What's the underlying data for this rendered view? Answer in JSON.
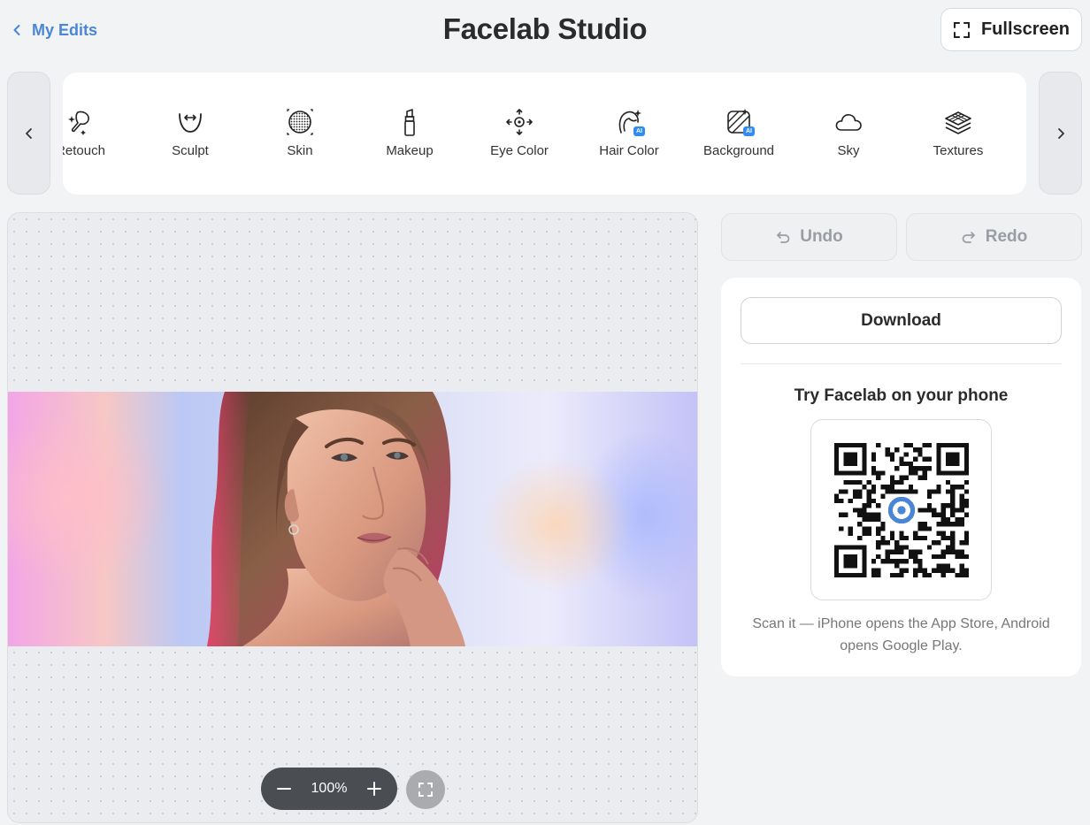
{
  "header": {
    "back_label": "My Edits",
    "title": "Facelab Studio",
    "fullscreen_label": "Fullscreen"
  },
  "tools": [
    {
      "label": "Retouch",
      "icon": "retouch-icon",
      "ai": false
    },
    {
      "label": "Sculpt",
      "icon": "sculpt-icon",
      "ai": false
    },
    {
      "label": "Skin",
      "icon": "skin-icon",
      "ai": false
    },
    {
      "label": "Makeup",
      "icon": "lipstick-icon",
      "ai": false
    },
    {
      "label": "Eye Color",
      "icon": "eye-move-icon",
      "ai": false
    },
    {
      "label": "Hair Color",
      "icon": "hair-icon",
      "ai": true
    },
    {
      "label": "Background",
      "icon": "background-icon",
      "ai": true
    },
    {
      "label": "Sky",
      "icon": "cloud-icon",
      "ai": false
    },
    {
      "label": "Textures",
      "icon": "layers-icon",
      "ai": false
    }
  ],
  "ai_badge": "AI",
  "canvas": {
    "zoom": "100%"
  },
  "history": {
    "undo_label": "Undo",
    "redo_label": "Redo"
  },
  "panel": {
    "download_label": "Download",
    "phone_title": "Try Facelab on your phone",
    "scan_text": "Scan it — iPhone opens the App Store, Android opens Google Play."
  },
  "colors": {
    "accent": "#4a86d6",
    "zoom_bar": "#4a4d52",
    "ai_badge": "#2f8cf0"
  }
}
